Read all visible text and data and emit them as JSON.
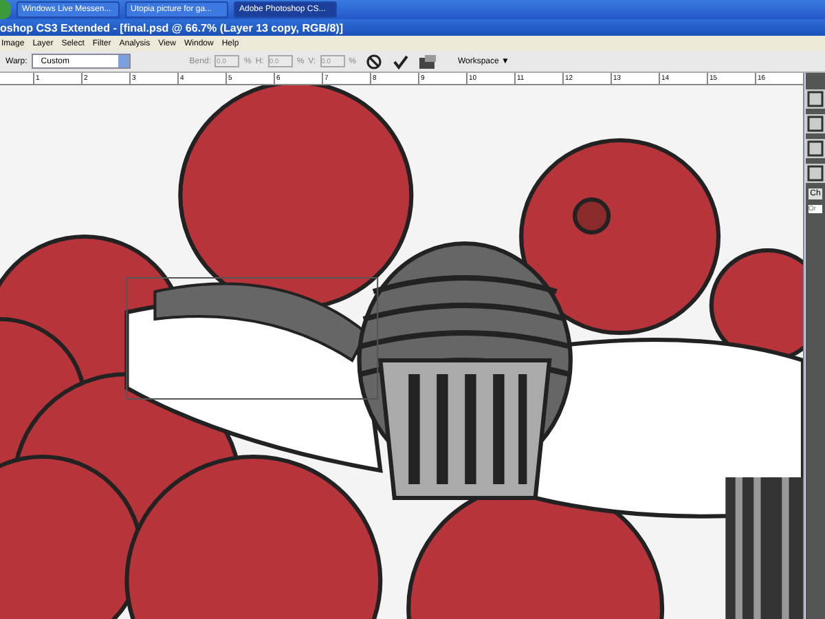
{
  "taskbar": {
    "buttons": [
      {
        "label": "Windows Live Messen...",
        "selected": false
      },
      {
        "label": "Utopia picture for ga...",
        "selected": false
      },
      {
        "label": "Adobe Photoshop CS...",
        "selected": true
      }
    ]
  },
  "window": {
    "title": "oshop CS3 Extended - [final.psd @ 66.7% (Layer 13 copy, RGB/8)]"
  },
  "menu": [
    "Image",
    "Layer",
    "Select",
    "Filter",
    "Analysis",
    "View",
    "Window",
    "Help"
  ],
  "options_bar": {
    "warp_label": "Warp:",
    "warp_value": "Custom",
    "fields": [
      {
        "label": "Bend:",
        "value": "0.0",
        "unit": "%"
      },
      {
        "label": "H:",
        "value": "0.0",
        "unit": "%"
      },
      {
        "label": "V:",
        "value": "0.0",
        "unit": "%"
      }
    ],
    "workspace": "Workspace ▼"
  },
  "ruler": [
    "1",
    "2",
    "3",
    "4",
    "5",
    "6",
    "7",
    "8",
    "9",
    "10",
    "11",
    "12",
    "13",
    "14",
    "15",
    "16"
  ],
  "panel": {
    "tab": "Ch",
    "field_placeholder": "Or"
  }
}
